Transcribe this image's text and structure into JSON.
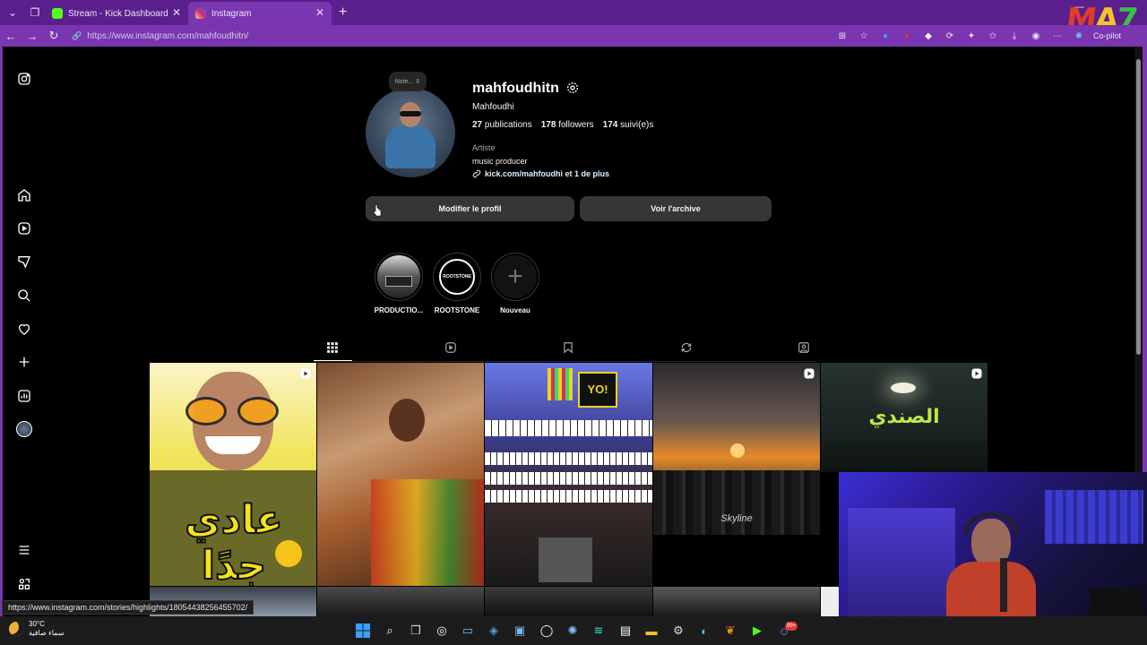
{
  "browser": {
    "tabs": [
      {
        "title": "Stream - Kick Dashboard",
        "favicon_color": "#53fc18"
      },
      {
        "title": "Instagram",
        "favicon_color": "#e1306c"
      }
    ],
    "url": "https://www.instagram.com/mahfoudhitn/",
    "copilot_label": "Co-pilot",
    "overlay_logo": [
      "M",
      "A",
      "7"
    ]
  },
  "sidebar": {
    "items": [
      {
        "icon": "instagram-logo-icon"
      },
      {
        "icon": "home-icon"
      },
      {
        "icon": "reels-icon"
      },
      {
        "icon": "messages-icon"
      },
      {
        "icon": "search-icon"
      },
      {
        "icon": "notifications-heart-icon"
      },
      {
        "icon": "create-plus-icon"
      },
      {
        "icon": "dashboard-icon"
      },
      {
        "icon": "profile-avatar-icon"
      },
      {
        "icon": "more-menu-icon"
      },
      {
        "icon": "also-from-meta-icon"
      }
    ]
  },
  "profile": {
    "note": "Note...",
    "username": "mahfoudhitn",
    "full_name": "Mahfoudhi",
    "posts_count": "27",
    "posts_label": "publications",
    "followers_count": "178",
    "followers_label": "followers",
    "following_count": "174",
    "following_label": "suivi(e)s",
    "category": "Artiste",
    "bio": "music producer",
    "link": "kick.com/mahfoudhi et 1 de plus",
    "edit_button": "Modifier le profil",
    "archive_button": "Voir l'archive"
  },
  "highlights": [
    {
      "label": "PRODUCTIO...",
      "inner_text": ""
    },
    {
      "label": "ROOTSTONE",
      "inner_text": "ROOTSTONE"
    },
    {
      "label": "Nouveau",
      "inner_text": "+"
    }
  ],
  "profile_tabs": [
    "posts-grid-icon",
    "reels-icon",
    "saved-icon",
    "reposts-icon",
    "tagged-icon"
  ],
  "posts": [
    {
      "caption": "عادي جدًا",
      "type": "reel",
      "accent": "#f2d61a"
    },
    {
      "caption": "",
      "type": "photo",
      "accent": "#b8733f"
    },
    {
      "caption": "YO!",
      "type": "photo",
      "accent": "#5a66d8"
    },
    {
      "caption": "Skyline",
      "type": "reel",
      "accent": "#d8742a"
    },
    {
      "caption": "الصندي",
      "type": "reel",
      "accent": "#2a3a38"
    }
  ],
  "status_bar_url": "https://www.instagram.com/stories/highlights/18054438256455702/",
  "taskbar": {
    "weather_temp": "30°C",
    "weather_desc": "سماء صافية",
    "notification_badge": "99+"
  }
}
